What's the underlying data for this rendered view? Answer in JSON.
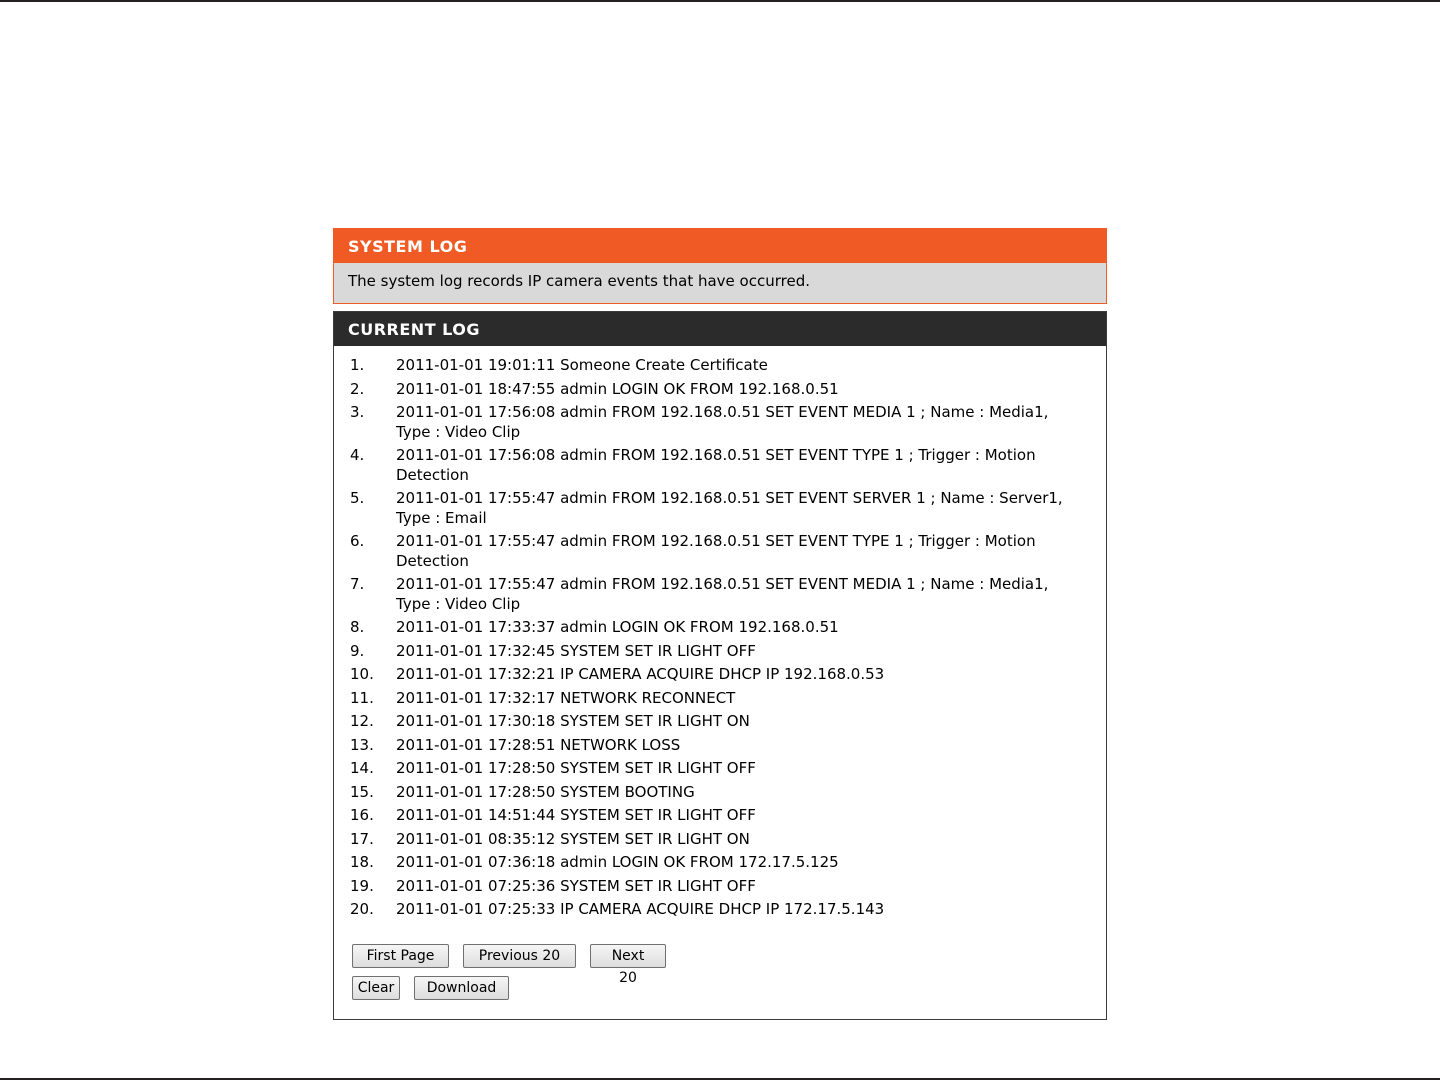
{
  "system_log": {
    "title": "SYSTEM LOG",
    "description": "The system log records IP camera events that have occurred."
  },
  "current_log": {
    "title": "CURRENT LOG",
    "entries": [
      {
        "num": "1.",
        "text": "2011-01-01 19:01:11 Someone Create Certificate"
      },
      {
        "num": "2.",
        "text": "2011-01-01 18:47:55 admin LOGIN OK FROM 192.168.0.51"
      },
      {
        "num": "3.",
        "text": "2011-01-01 17:56:08 admin FROM 192.168.0.51 SET EVENT MEDIA 1 ; Name : Media1, Type : Video Clip"
      },
      {
        "num": "4.",
        "text": "2011-01-01 17:56:08 admin FROM 192.168.0.51 SET EVENT TYPE 1 ; Trigger : Motion Detection"
      },
      {
        "num": "5.",
        "text": "2011-01-01 17:55:47 admin FROM 192.168.0.51 SET EVENT SERVER 1 ; Name : Server1, Type : Email"
      },
      {
        "num": "6.",
        "text": "2011-01-01 17:55:47 admin FROM 192.168.0.51 SET EVENT TYPE 1 ; Trigger : Motion Detection"
      },
      {
        "num": "7.",
        "text": "2011-01-01 17:55:47 admin FROM 192.168.0.51 SET EVENT MEDIA 1 ; Name : Media1, Type : Video Clip"
      },
      {
        "num": "8.",
        "text": "2011-01-01 17:33:37 admin LOGIN OK FROM 192.168.0.51"
      },
      {
        "num": "9.",
        "text": "2011-01-01 17:32:45 SYSTEM SET IR LIGHT OFF"
      },
      {
        "num": "10.",
        "text": "2011-01-01 17:32:21 IP CAMERA ACQUIRE DHCP IP 192.168.0.53"
      },
      {
        "num": "11.",
        "text": "2011-01-01 17:32:17 NETWORK RECONNECT"
      },
      {
        "num": "12.",
        "text": "2011-01-01 17:30:18 SYSTEM SET IR LIGHT ON"
      },
      {
        "num": "13.",
        "text": "2011-01-01 17:28:51 NETWORK LOSS"
      },
      {
        "num": "14.",
        "text": "2011-01-01 17:28:50 SYSTEM SET IR LIGHT OFF"
      },
      {
        "num": "15.",
        "text": "2011-01-01 17:28:50 SYSTEM BOOTING"
      },
      {
        "num": "16.",
        "text": "2011-01-01 14:51:44 SYSTEM SET IR LIGHT OFF"
      },
      {
        "num": "17.",
        "text": "2011-01-01 08:35:12 SYSTEM SET IR LIGHT ON"
      },
      {
        "num": "18.",
        "text": "2011-01-01 07:36:18 admin LOGIN OK FROM 172.17.5.125"
      },
      {
        "num": "19.",
        "text": "2011-01-01 07:25:36 SYSTEM SET IR LIGHT OFF"
      },
      {
        "num": "20.",
        "text": "2011-01-01 07:25:33 IP CAMERA ACQUIRE DHCP IP 172.17.5.143"
      }
    ]
  },
  "buttons": {
    "first_page": "First Page",
    "previous": "Previous 20",
    "next": "Next 20",
    "clear": "Clear",
    "download": "Download"
  },
  "colors": {
    "system_log_header": "#f05a24",
    "current_log_header": "#2b2b2b",
    "description_bg": "#d9d9d9"
  }
}
